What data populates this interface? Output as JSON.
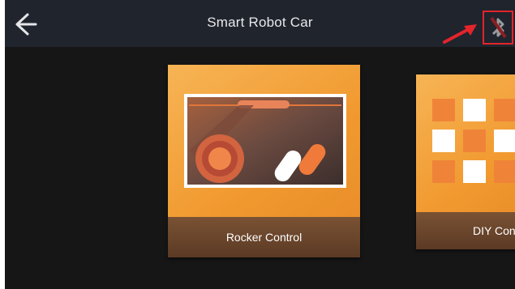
{
  "header": {
    "title": "Smart Robot Car",
    "back_icon": "back-arrow-icon",
    "bluetooth_icon": "bluetooth-disconnected-icon"
  },
  "cards": [
    {
      "label": "Rocker Control",
      "icon": "gamepad-icon"
    },
    {
      "label": "DIY Control",
      "icon": "grid-buttons-icon"
    }
  ],
  "colors": {
    "header_bg": "#20242d",
    "screen_bg": "#161616",
    "card_orange": "#f3a13b",
    "label_bar": "#5b3a24",
    "annotation_red": "#e3242b"
  }
}
